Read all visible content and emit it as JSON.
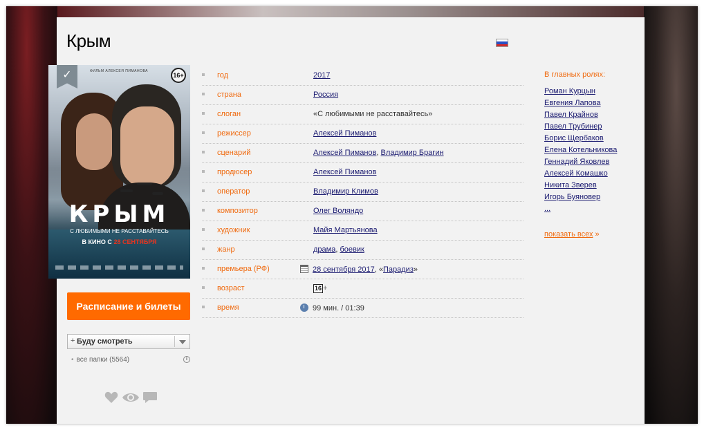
{
  "movie": {
    "title": "Крым",
    "flag_icon": "russian-flag-icon"
  },
  "poster": {
    "top_line": "ФИЛЬМ АЛЕКСЕЯ ПИМАНОВА",
    "age_badge": "16+",
    "title": "КРЫМ",
    "tagline": "С ЛЮБИМЫМИ НЕ РАССТАВАЙТЕСЬ",
    "release_prefix": "В КИНО С",
    "release_date": "28 СЕНТЯБРЯ",
    "ribbon_icon": "check-ribbon-icon"
  },
  "sidebar": {
    "tickets_button": "Расписание и билеты",
    "watch_select": {
      "plus": "+",
      "selected": "Буду смотреть"
    },
    "folders": "все папки (5564)",
    "info_icon": "i",
    "actions": [
      "heart-icon",
      "eye-icon",
      "comment-icon"
    ]
  },
  "info": {
    "rows": [
      {
        "key": "год",
        "values": [
          "2017"
        ]
      },
      {
        "key": "страна",
        "values": [
          "Россия"
        ]
      },
      {
        "key": "слоган",
        "text": "«С любимыми не расставайтесь»"
      },
      {
        "key": "режиссер",
        "values": [
          "Алексей Пиманов"
        ]
      },
      {
        "key": "сценарий",
        "values": [
          "Алексей Пиманов",
          "Владимир Брагин"
        ]
      },
      {
        "key": "продюсер",
        "values": [
          "Алексей Пиманов"
        ]
      },
      {
        "key": "оператор",
        "values": [
          "Владимир Климов"
        ]
      },
      {
        "key": "композитор",
        "values": [
          "Олег Воляндо"
        ]
      },
      {
        "key": "художник",
        "values": [
          "Майя Мартьянова"
        ]
      },
      {
        "key": "жанр",
        "values": [
          "драма",
          "боевик"
        ]
      },
      {
        "key": "премьера (РФ)",
        "date": "28 сентября 2017",
        "sep": ", «",
        "studio": "Парадиз",
        "close": "»"
      },
      {
        "key": "возраст",
        "badge": "16",
        "plus": "+"
      },
      {
        "key": "время",
        "text": "99 мин. / 01:39"
      }
    ]
  },
  "cast": {
    "title": "В главных ролях:",
    "actors": [
      "Роман Курцын",
      "Евгения Лапова",
      "Павел Крайнов",
      "Павел Трубинер",
      "Борис Щербаков",
      "Елена Котельникова",
      "Геннадий Яковлев",
      "Алексей Комашко",
      "Никита Зверев",
      "Игорь Буяновер",
      "..."
    ],
    "show_all": "показать всех",
    "show_all_arrow": "»"
  },
  "colors": {
    "accent_orange": "#f06a0f",
    "button_orange": "#ff6a00",
    "link_blue": "#1a1a70",
    "panel_bg": "#f2f2f2"
  }
}
